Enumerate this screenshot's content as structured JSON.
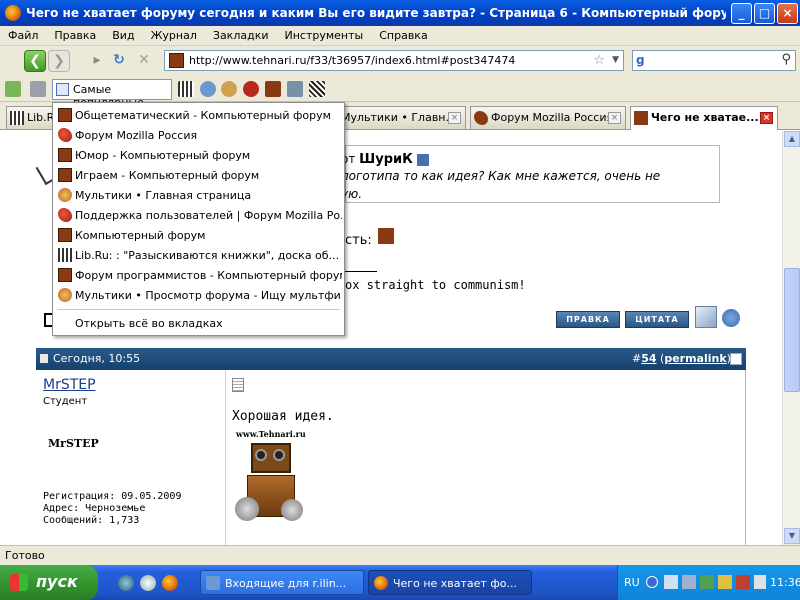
{
  "window": {
    "title": "Чего не хватает форуму сегодня и каким Вы его видите завтра? - Страница 6 - Компьютерный форум - Mozi...",
    "minimize": "_",
    "maximize": "□",
    "close": "×"
  },
  "menu": [
    "Файл",
    "Правка",
    "Вид",
    "Журнал",
    "Закладки",
    "Инструменты",
    "Справка"
  ],
  "nav": {
    "url": "http://www.tehnari.ru/f33/t36957/index6.html#post347474",
    "search_value": ""
  },
  "bookmarks_toolbar": {
    "popular_label": "Самые популярные"
  },
  "tabs": [
    {
      "label": "Lib.R..."
    },
    {
      "label": "Мультики • Главн..."
    },
    {
      "label": "Форум Mozilla Россия"
    },
    {
      "label": "Чего не хватае..."
    }
  ],
  "popular_menu": {
    "items": [
      {
        "label": "Общетематический - Компьютерный форум",
        "icon": "forum-icon"
      },
      {
        "label": "Форум Mozilla Россия",
        "icon": "mozilla-icon"
      },
      {
        "label": "Юмор - Компьютерный форум",
        "icon": "forum-icon"
      },
      {
        "label": "Играем - Компьютерный форум",
        "icon": "forum-icon"
      },
      {
        "label": "Мультики • Главная страница",
        "icon": "cartoon-icon"
      },
      {
        "label": "Поддержка пользователей | Форум Mozilla Ро...",
        "icon": "mozilla-icon"
      },
      {
        "label": "Компьютерный форум",
        "icon": "forum-icon"
      },
      {
        "label": "Lib.Ru: : \"Разыскиваются книжки\", доска об...",
        "icon": "lib-icon"
      },
      {
        "label": "Форум программистов - Компьютерный форум",
        "icon": "forum-icon"
      },
      {
        "label": "Мультики • Просмотр форума - Ищу мультфи...",
        "icon": "cartoon-icon"
      }
    ],
    "open_all": "Открыть всё во вкладках"
  },
  "post_prev": {
    "quote_prefix": "от",
    "quote_author": "ШуриК",
    "quote_text_1": "логотипа то как идея? Как мне кажется, очень не",
    "quote_text_2": "ую.",
    "side_text": "сть:",
    "signature": "ox straight to communism!",
    "edit_button": "ПРАВКА",
    "quote_button": "ЦИТАТА"
  },
  "post": {
    "date": "Сегодня, 10:55",
    "number_prefix": "#",
    "number": "54",
    "permalink": "permalink",
    "username": "MrSTEP",
    "rank": "Студент",
    "avatar_text": "MrSTEP",
    "reg_date": "Регистрация: 09.05.2009",
    "address": "Адрес: Черноземье",
    "messages": "Сообщений: 1,733",
    "message": "Хорошая идея.",
    "image_caption": "www.Tehnari.ru"
  },
  "status": {
    "text": "Готово"
  },
  "taskbar": {
    "start": "пуск",
    "items": [
      {
        "label": "Входящие для r.ilin..."
      },
      {
        "label": "Чего не хватает фо..."
      }
    ],
    "lang": "RU",
    "time": "11:36"
  }
}
